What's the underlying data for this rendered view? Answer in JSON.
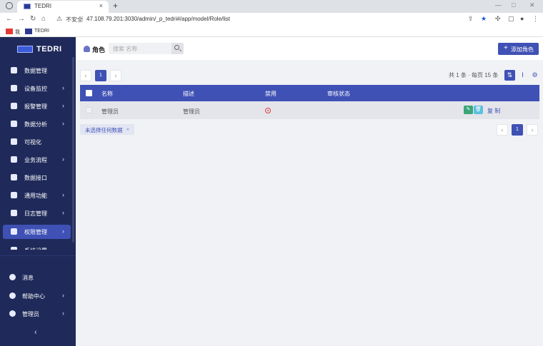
{
  "browser": {
    "tab_title": "TEDRI",
    "tab_close": "×",
    "new_tab": "+",
    "nav": {
      "back": "←",
      "forward": "→",
      "reload": "↻",
      "home": "⌂"
    },
    "insecure_label": "不安全",
    "separator": "|",
    "url": "47.108.79.201:3030/admin/_p_tedri#/app/model/Role/list",
    "bookmarks": [
      {
        "label": "我",
        "icon": "red-site-icon",
        "color": "#e53935"
      },
      {
        "label": "TEDRI",
        "icon": "tedri-site-icon",
        "color": "#2b3b93"
      }
    ]
  },
  "sidebar": {
    "brand": "TEDRI",
    "items": [
      {
        "label": "数据管理",
        "arrow": "",
        "icon": "table-icon"
      },
      {
        "label": "设备监控",
        "arrow": "›",
        "icon": "monitor-icon"
      },
      {
        "label": "报警管理",
        "arrow": "›",
        "icon": "alarm-icon"
      },
      {
        "label": "数据分析",
        "arrow": "›",
        "icon": "chart-icon"
      },
      {
        "label": "可视化",
        "arrow": "",
        "icon": "visual-icon"
      },
      {
        "label": "业务流程",
        "arrow": "›",
        "icon": "flow-icon"
      },
      {
        "label": "数据接口",
        "arrow": "",
        "icon": "api-icon"
      },
      {
        "label": "通用功能",
        "arrow": "›",
        "icon": "apps-icon"
      },
      {
        "label": "日志管理",
        "arrow": "›",
        "icon": "log-icon"
      },
      {
        "label": "权限管理",
        "arrow": "›",
        "icon": "permission-icon",
        "active": true
      },
      {
        "label": "系统设置",
        "arrow": "",
        "icon": "settings-icon"
      }
    ],
    "bottom": [
      {
        "label": "消息",
        "arrow": "",
        "icon": "message-icon"
      },
      {
        "label": "帮助中心",
        "arrow": "›",
        "icon": "help-icon"
      },
      {
        "label": "管理员",
        "arrow": "›",
        "icon": "user-icon"
      }
    ],
    "collapse": "‹"
  },
  "header": {
    "title": "角色",
    "search_placeholder": "搜索 名称",
    "add_button": "添加角色",
    "add_plus": "+"
  },
  "pagination": {
    "prev": "‹",
    "next": "›",
    "current": "1",
    "summary": "共 1 条 · 每页 15 条"
  },
  "toolbar": {
    "sort": "⇅",
    "columns": "Ⅰ",
    "settings": "⚙"
  },
  "table": {
    "columns": [
      "名称",
      "描述",
      "禁用",
      "审核状态"
    ],
    "rows": [
      {
        "name": "管理员",
        "description": "管理员",
        "disabled": false,
        "audit": "",
        "copy_label": "复 制"
      }
    ]
  },
  "selection": {
    "label": "未选择任何数据",
    "chevron": "⌄"
  },
  "colors": {
    "primary": "#3f51b5",
    "sidebar": "#1f2a5a",
    "edit": "#3aa67a",
    "delete": "#5bc1df",
    "disabled_icon": "#e03b3b"
  }
}
